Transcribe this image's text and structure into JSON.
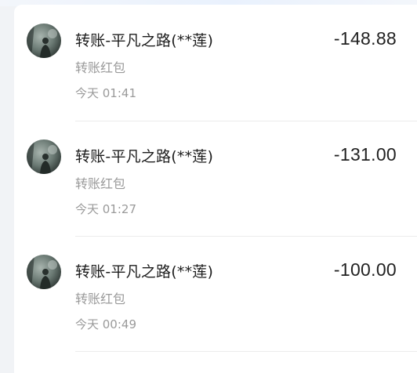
{
  "transactions": [
    {
      "title": "转账-平凡之路(**莲)",
      "amount": "-148.88",
      "category": "转账红包",
      "time": "今天 01:41"
    },
    {
      "title": "转账-平凡之路(**莲)",
      "amount": "-131.00",
      "category": "转账红包",
      "time": "今天 01:27"
    },
    {
      "title": "转账-平凡之路(**莲)",
      "amount": "-100.00",
      "category": "转账红包",
      "time": "今天 00:49"
    }
  ],
  "icons": {
    "avatar": "user-avatar-icon"
  }
}
